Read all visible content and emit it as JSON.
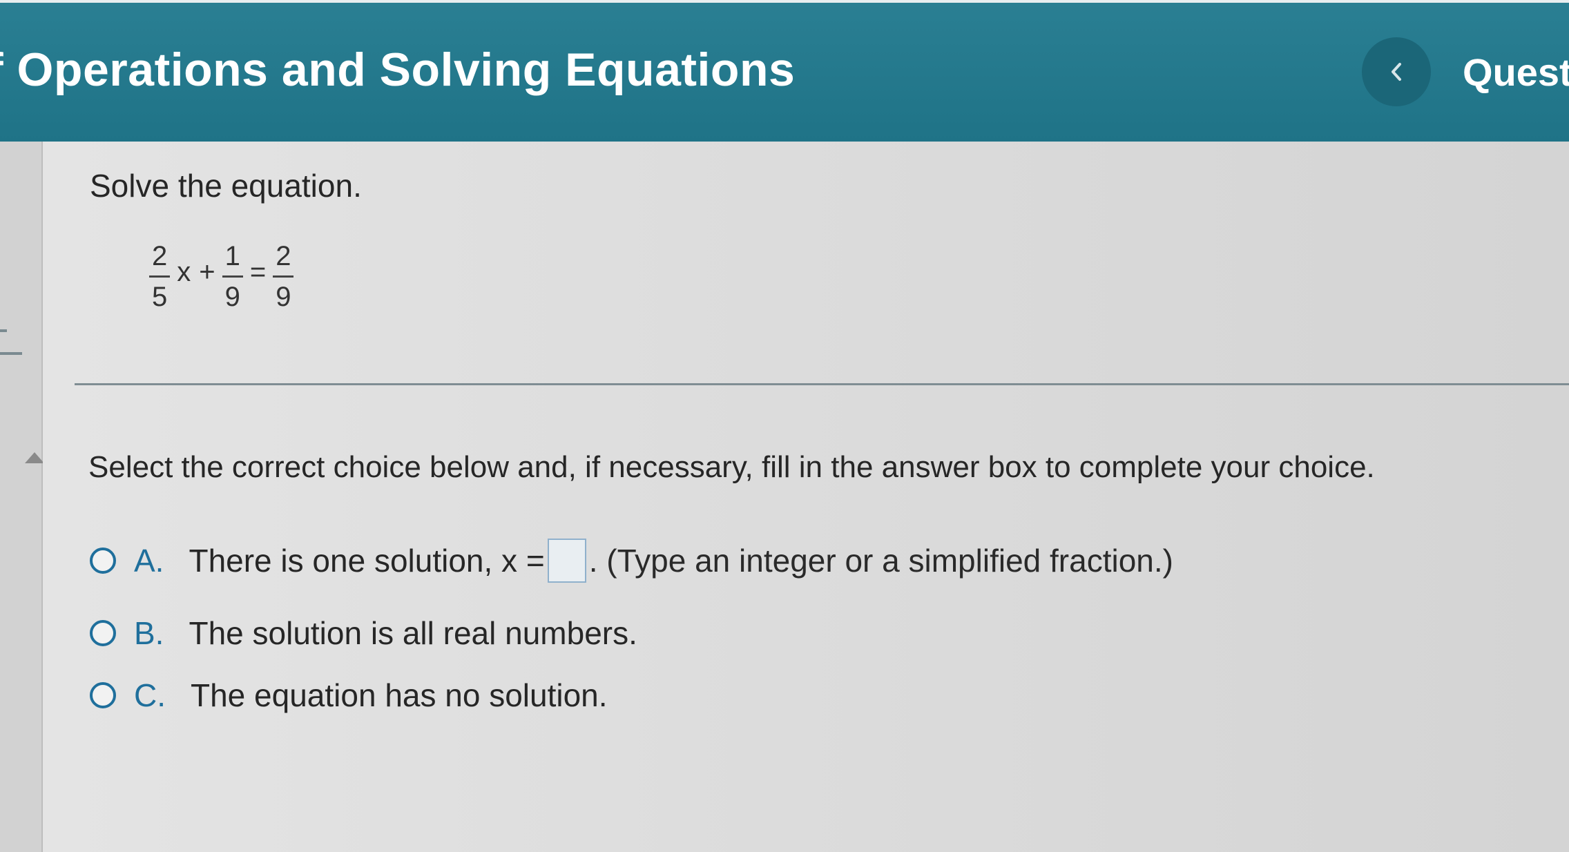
{
  "header": {
    "title": "f Operations and Solving Equations",
    "question_label": "Quest",
    "prev_icon": "chevron-left-icon"
  },
  "problem": {
    "prompt": "Solve the equation.",
    "equation": {
      "term1": {
        "numerator": "2",
        "denominator": "5"
      },
      "variable": "x",
      "plus": "+",
      "term2": {
        "numerator": "1",
        "denominator": "9"
      },
      "equals": "=",
      "rhs": {
        "numerator": "2",
        "denominator": "9"
      }
    }
  },
  "instruction": "Select the correct choice below and, if necessary, fill in the answer box to complete your choice.",
  "choices": [
    {
      "letter": "A.",
      "text_before": "There is one solution, x =",
      "text_after": ". (Type an integer or a simplified fraction.)"
    },
    {
      "letter": "B.",
      "text": "The solution is all real numbers."
    },
    {
      "letter": "C.",
      "text": "The equation has no solution."
    }
  ],
  "colors": {
    "header_bg": "#1f7387",
    "accent": "#1f6f9c"
  }
}
